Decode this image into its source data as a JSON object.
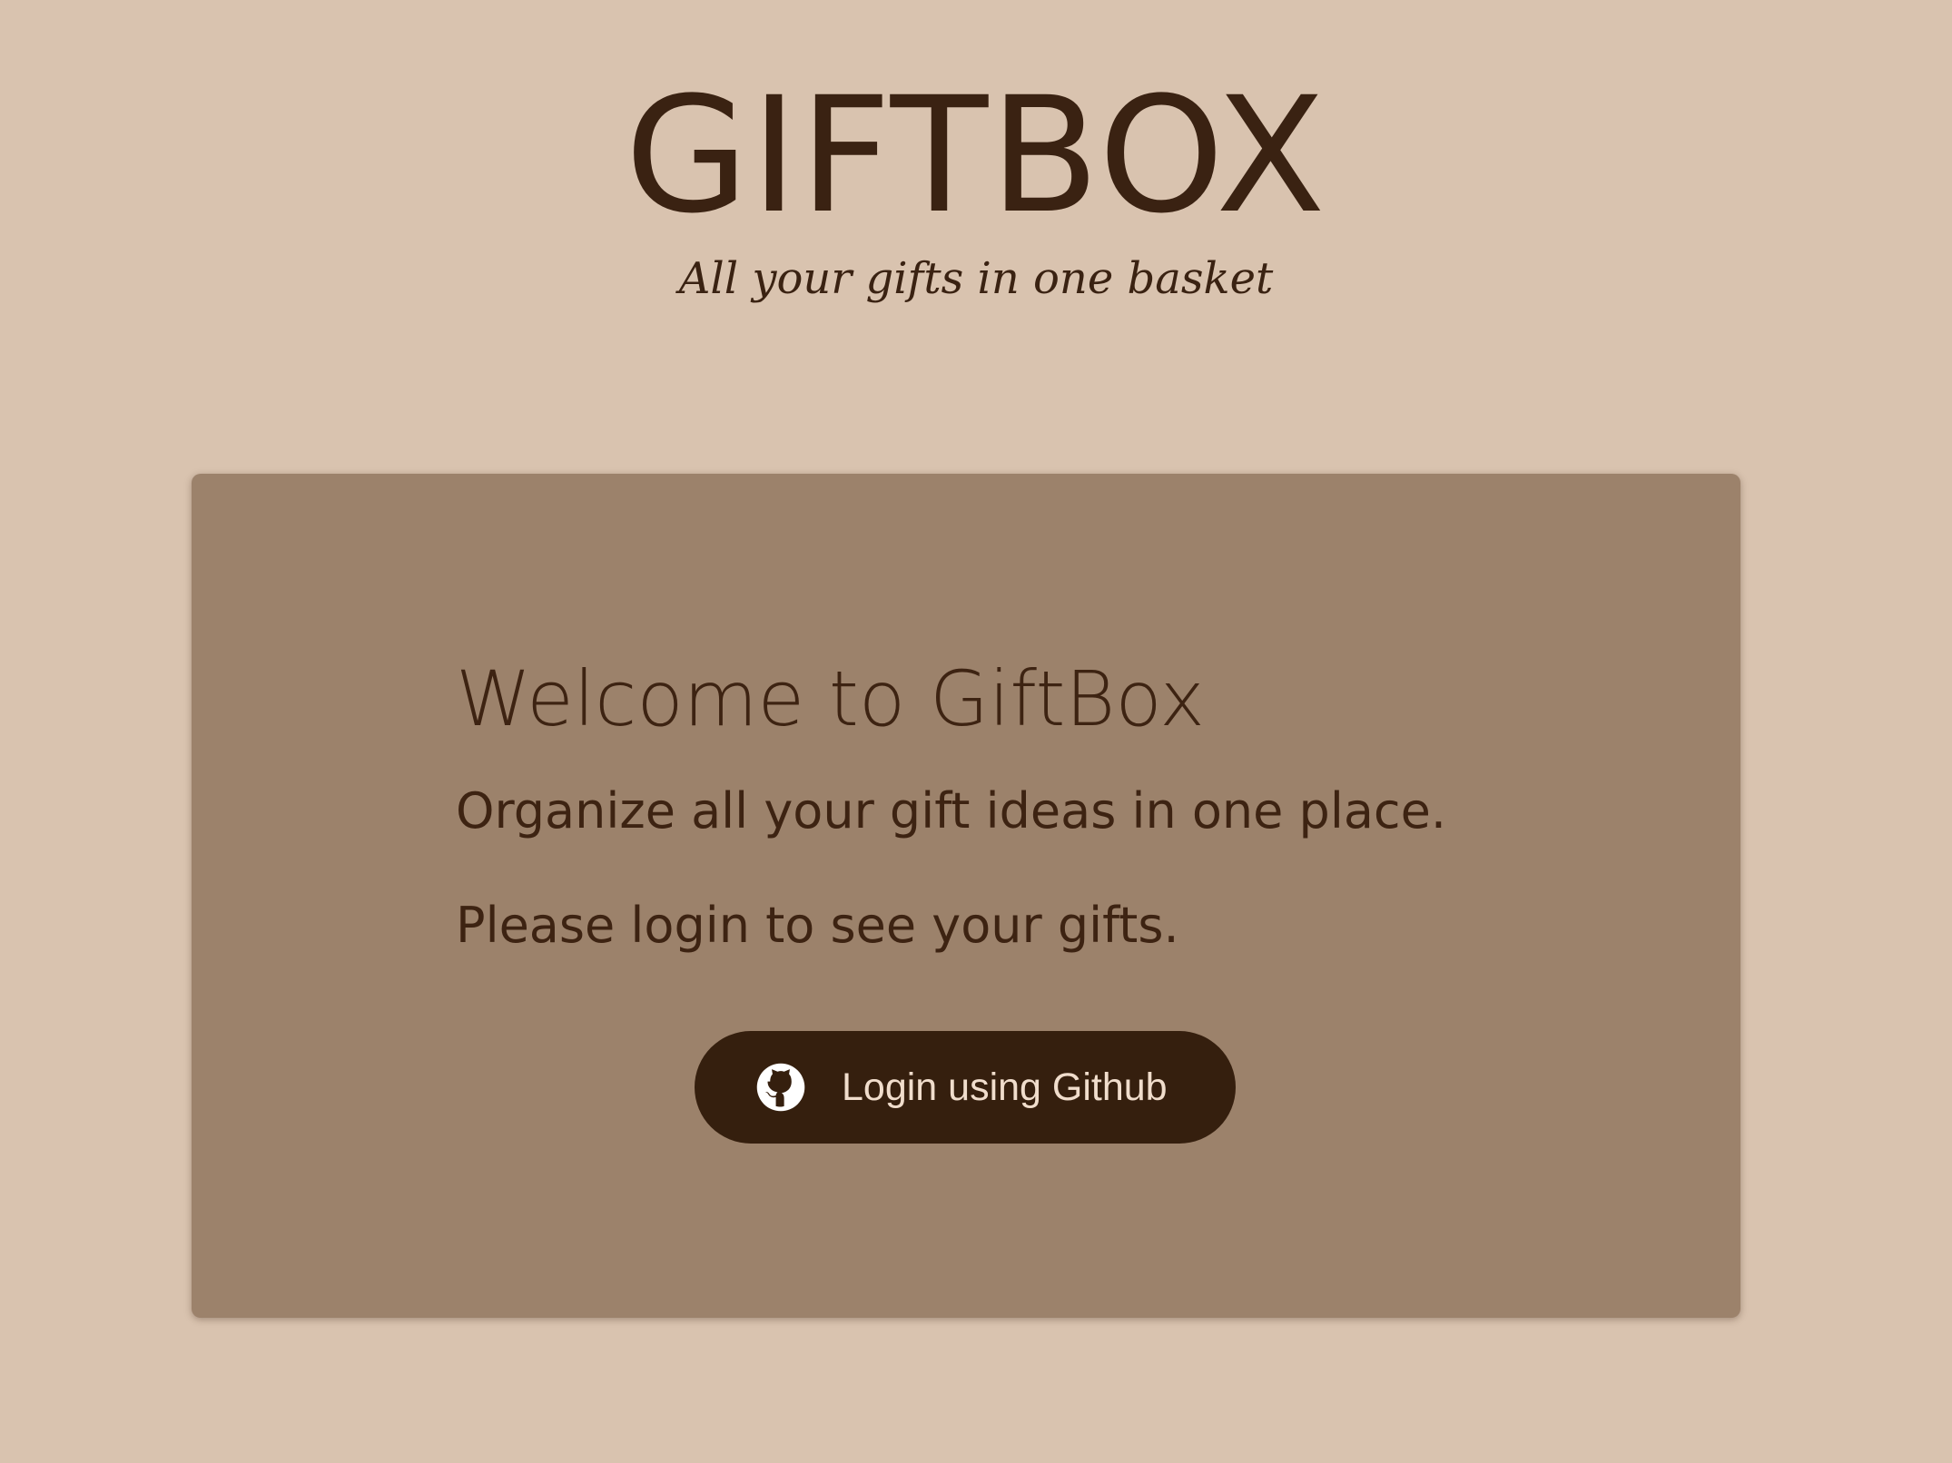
{
  "header": {
    "brand": "GIFTBOX",
    "tagline": "All your gifts in one basket"
  },
  "welcome_card": {
    "heading": "Welcome to GiftBox",
    "intro": "Organize all your gift ideas in one place.",
    "login_prompt": "Please login to see your gifts.",
    "login_button": {
      "label": "Login using Github",
      "icon": "github-icon"
    }
  },
  "colors": {
    "page_background": "#d9c3af",
    "card_background": "#9c826b",
    "text": "#3a2212",
    "button_background": "#351f0e",
    "button_text": "#f0ddcc"
  }
}
